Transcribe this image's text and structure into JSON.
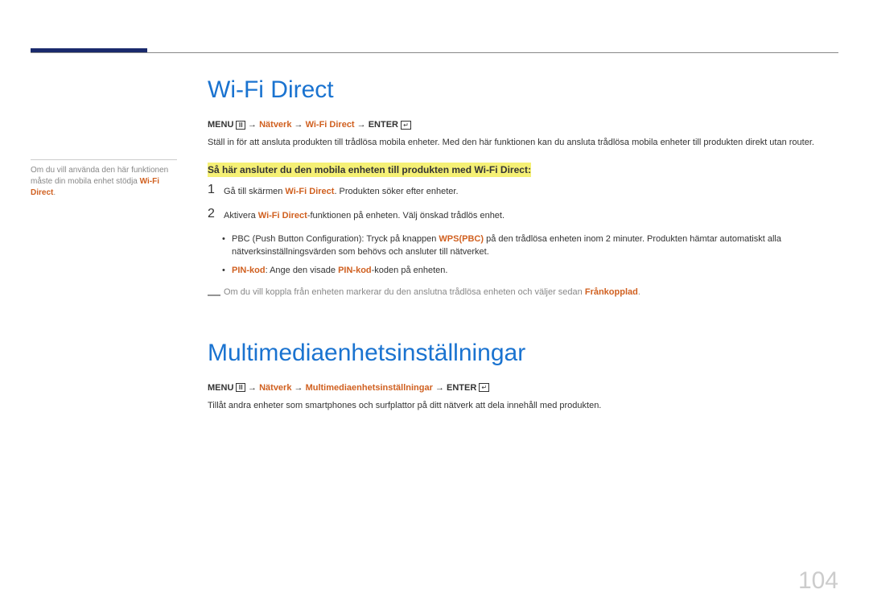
{
  "sidebar": {
    "note_prefix": "Om du vill använda den här funktionen måste din mobila enhet stödja ",
    "note_brand": "Wi-Fi Direct",
    "note_suffix": "."
  },
  "section1": {
    "title": "Wi-Fi Direct",
    "menu": {
      "menu": "MENU",
      "arrow": "→",
      "path1": "Nätverk",
      "path2": "Wi-Fi Direct",
      "enter": "ENTER"
    },
    "intro": "Ställ in för att ansluta produkten till trådlösa mobila enheter. Med den här funktionen kan du ansluta trådlösa mobila enheter till produkten direkt utan router.",
    "instruction_heading": "Så här ansluter du den mobila enheten till produkten med Wi-Fi Direct:",
    "step1": {
      "num": "1",
      "prefix": "Gå till skärmen ",
      "bold": "Wi-Fi Direct",
      "suffix": ". Produkten söker efter enheter."
    },
    "step2": {
      "num": "2",
      "prefix": "Aktivera ",
      "bold": "Wi-Fi Direct",
      "suffix": "-funktionen på enheten. Välj önskad trådlös enhet."
    },
    "bullet1": {
      "prefix": "PBC (Push Button Configuration): Tryck på knappen ",
      "bold": "WPS(PBC)",
      "suffix": " på den trådlösa enheten inom 2 minuter. Produkten hämtar automatiskt alla nätverksinställningsvärden som behövs och ansluter till nätverket."
    },
    "bullet2": {
      "bold1": "PIN-kod",
      "mid": ": Ange den visade ",
      "bold2": "PIN-kod",
      "suffix": "-koden på enheten."
    },
    "note": {
      "prefix": "Om du vill koppla från enheten markerar du den anslutna trådlösa enheten och väljer sedan ",
      "bold": "Frånkopplad",
      "suffix": "."
    }
  },
  "section2": {
    "title": "Multimediaenhetsinställningar",
    "menu": {
      "menu": "MENU",
      "arrow": "→",
      "path1": "Nätverk",
      "path2": "Multimediaenhetsinställningar",
      "enter": "ENTER"
    },
    "intro": "Tillåt andra enheter som smartphones och surfplattor på ditt nätverk att dela innehåll med produkten."
  },
  "pageNumber": "104"
}
